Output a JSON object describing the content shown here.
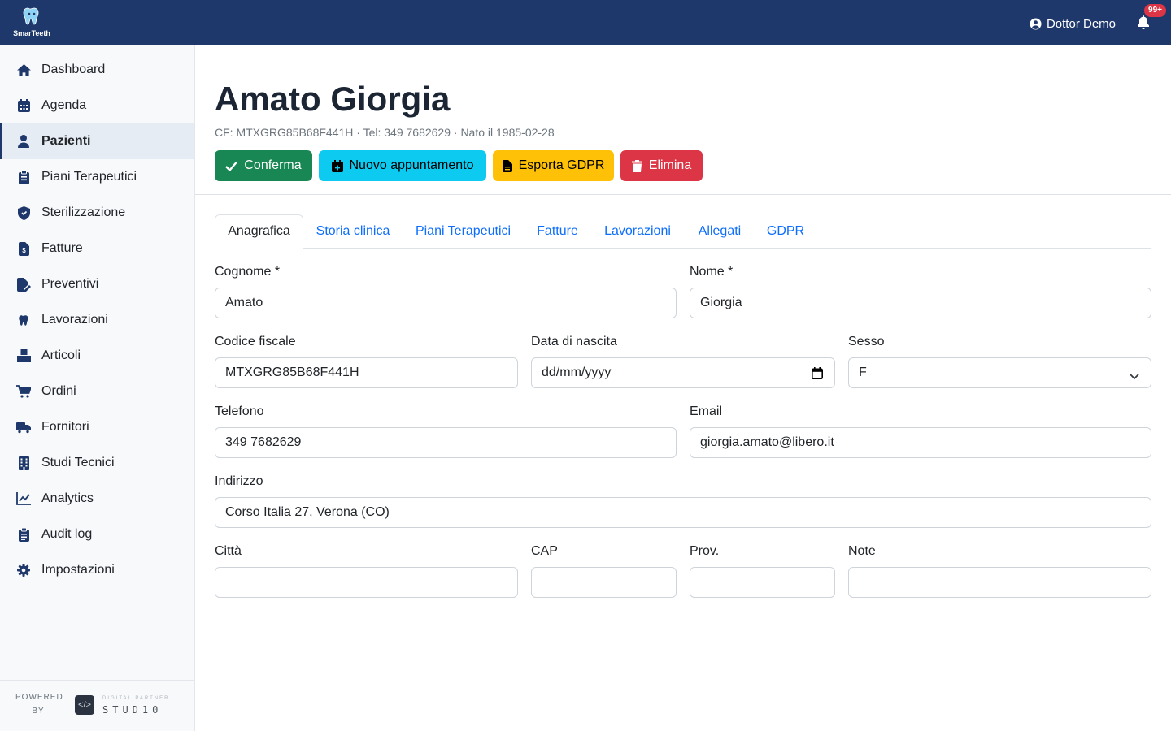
{
  "app": {
    "name": "SmarTeeth"
  },
  "topbar": {
    "user_name": "Dottor Demo",
    "notifications_badge": "99+"
  },
  "sidebar": {
    "items": [
      {
        "label": "Dashboard",
        "icon": "home-icon"
      },
      {
        "label": "Agenda",
        "icon": "calendar-icon"
      },
      {
        "label": "Pazienti",
        "icon": "user-icon",
        "active": true
      },
      {
        "label": "Piani Terapeutici",
        "icon": "clipboard-icon"
      },
      {
        "label": "Sterilizzazione",
        "icon": "shield-icon"
      },
      {
        "label": "Fatture",
        "icon": "invoice-icon"
      },
      {
        "label": "Preventivi",
        "icon": "file-pen-icon"
      },
      {
        "label": "Lavorazioni",
        "icon": "tooth-icon"
      },
      {
        "label": "Articoli",
        "icon": "boxes-icon"
      },
      {
        "label": "Ordini",
        "icon": "cart-icon"
      },
      {
        "label": "Fornitori",
        "icon": "truck-icon"
      },
      {
        "label": "Studi Tecnici",
        "icon": "building-icon"
      },
      {
        "label": "Analytics",
        "icon": "chart-line-icon"
      },
      {
        "label": "Audit log",
        "icon": "clipboard-list-icon"
      },
      {
        "label": "Impostazioni",
        "icon": "gear-icon"
      }
    ],
    "footer": {
      "powered_by": "POWERED BY",
      "partner_label": "DIGITAL PARTNER",
      "partner_name": "STUD10"
    }
  },
  "patient": {
    "title": "Amato Giorgia",
    "subtitle": "CF: MTXGRG85B68F441H · Tel: 349 7682629 · Nato il 1985-02-28"
  },
  "actions": {
    "confirm": "Conferma",
    "new_appointment": "Nuovo appuntamento",
    "export_gdpr": "Esporta GDPR",
    "delete": "Elimina"
  },
  "tabs": [
    "Anagrafica",
    "Storia clinica",
    "Piani Terapeutici",
    "Fatture",
    "Lavorazioni",
    "Allegati",
    "GDPR"
  ],
  "form": {
    "cognome": {
      "label": "Cognome *",
      "value": "Amato"
    },
    "nome": {
      "label": "Nome *",
      "value": "Giorgia"
    },
    "codice_fiscale": {
      "label": "Codice fiscale",
      "value": "MTXGRG85B68F441H"
    },
    "data_nascita": {
      "label": "Data di nascita",
      "value": "dd/mm/yyyy"
    },
    "sesso": {
      "label": "Sesso",
      "value": "F"
    },
    "telefono": {
      "label": "Telefono",
      "value": "349 7682629"
    },
    "email": {
      "label": "Email",
      "value": "giorgia.amato@libero.it"
    },
    "indirizzo": {
      "label": "Indirizzo",
      "value": "Corso Italia 27, Verona (CO)"
    },
    "citta": {
      "label": "Città",
      "value": ""
    },
    "cap": {
      "label": "CAP",
      "value": ""
    },
    "prov": {
      "label": "Prov.",
      "value": ""
    },
    "note": {
      "label": "Note",
      "value": ""
    }
  },
  "colors": {
    "topbar": "#1f386b",
    "confirm": "#198754",
    "appointment": "#0dcaf0",
    "gdpr": "#ffc107",
    "delete": "#dc3545",
    "link": "#0d6efd"
  }
}
